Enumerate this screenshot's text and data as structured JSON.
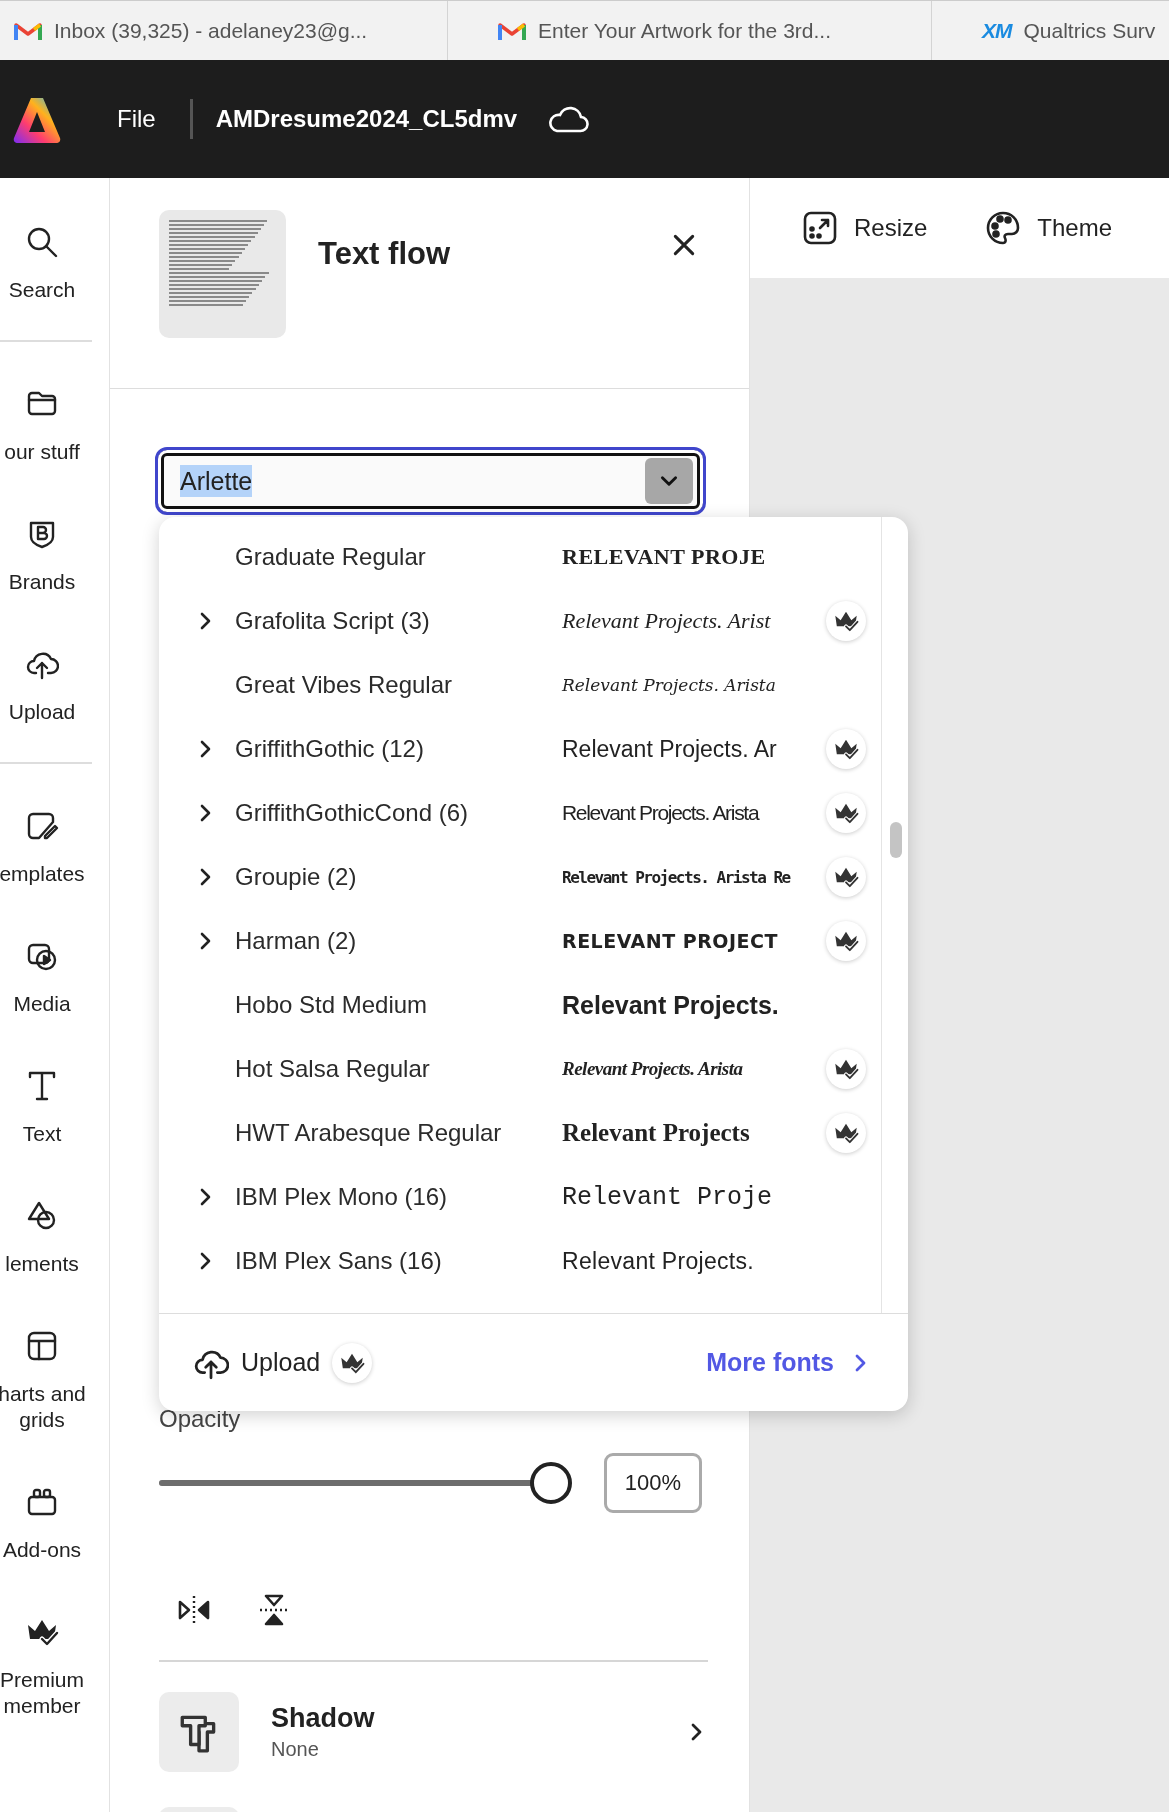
{
  "browser_tabs": [
    {
      "title": "Inbox (39,325) - adelaney23@g..."
    },
    {
      "title": "Enter Your Artwork for the 3rd..."
    },
    {
      "logo_text": "XM",
      "title": "Qualtrics Surv"
    }
  ],
  "app_bar": {
    "menu": "File",
    "document_title": "AMDresume2024_CL5dmv"
  },
  "rail_groups": [
    [
      {
        "label": "Search"
      }
    ],
    [
      {
        "label": "our stuff"
      },
      {
        "label": "Brands"
      },
      {
        "label": "Upload"
      }
    ],
    [
      {
        "label": "emplates"
      },
      {
        "label": "Media"
      },
      {
        "label": "Text"
      },
      {
        "label": "lements"
      },
      {
        "label": "harts and grids"
      },
      {
        "label": "Add-ons"
      },
      {
        "label": "Premium member"
      }
    ]
  ],
  "toolbar": [
    {
      "label": "Resize"
    },
    {
      "label": "Theme"
    }
  ],
  "panel": {
    "title": "Text flow",
    "font_field": {
      "value": "Arlette",
      "text_selected": true
    },
    "font_menu": {
      "fonts": [
        {
          "name": "Graduate Regular",
          "expandable": false,
          "preview": "RELEVANT PROJE",
          "premium": false
        },
        {
          "name": "Grafolita Script (3)",
          "expandable": true,
          "preview": "Relevant Projects. Arist",
          "premium": true
        },
        {
          "name": "Great Vibes Regular",
          "expandable": false,
          "preview": "Relevant Projects. Arista",
          "premium": false
        },
        {
          "name": "GriffithGothic (12)",
          "expandable": true,
          "preview": "Relevant Projects. Ar",
          "premium": true
        },
        {
          "name": "GriffithGothicCond (6)",
          "expandable": true,
          "preview": "Relevant Projects. Arista",
          "premium": true
        },
        {
          "name": "Groupie (2)",
          "expandable": true,
          "preview": "Relevant Projects. Arista Re",
          "premium": true
        },
        {
          "name": "Harman (2)",
          "expandable": true,
          "preview": "RELEVANT PROJECT",
          "premium": true
        },
        {
          "name": "Hobo Std Medium",
          "expandable": false,
          "preview": "Relevant Projects.",
          "premium": false
        },
        {
          "name": "Hot Salsa Regular",
          "expandable": false,
          "preview": "Relevant Projects. Arista",
          "premium": true
        },
        {
          "name": "HWT Arabesque Regular",
          "expandable": false,
          "preview": "Relevant Projects",
          "premium": true
        },
        {
          "name": "IBM Plex Mono (16)",
          "expandable": true,
          "preview": "Relevant Proje",
          "premium": false
        },
        {
          "name": "IBM Plex Sans (16)",
          "expandable": true,
          "preview": "Relevant Projects.",
          "premium": false
        }
      ],
      "footer": {
        "upload": "Upload",
        "upload_premium": true,
        "more": "More fonts"
      }
    },
    "opacity": {
      "label": "Opacity",
      "level": 1,
      "value": "100%"
    },
    "shadow": {
      "title": "Shadow",
      "value": "None"
    }
  }
}
